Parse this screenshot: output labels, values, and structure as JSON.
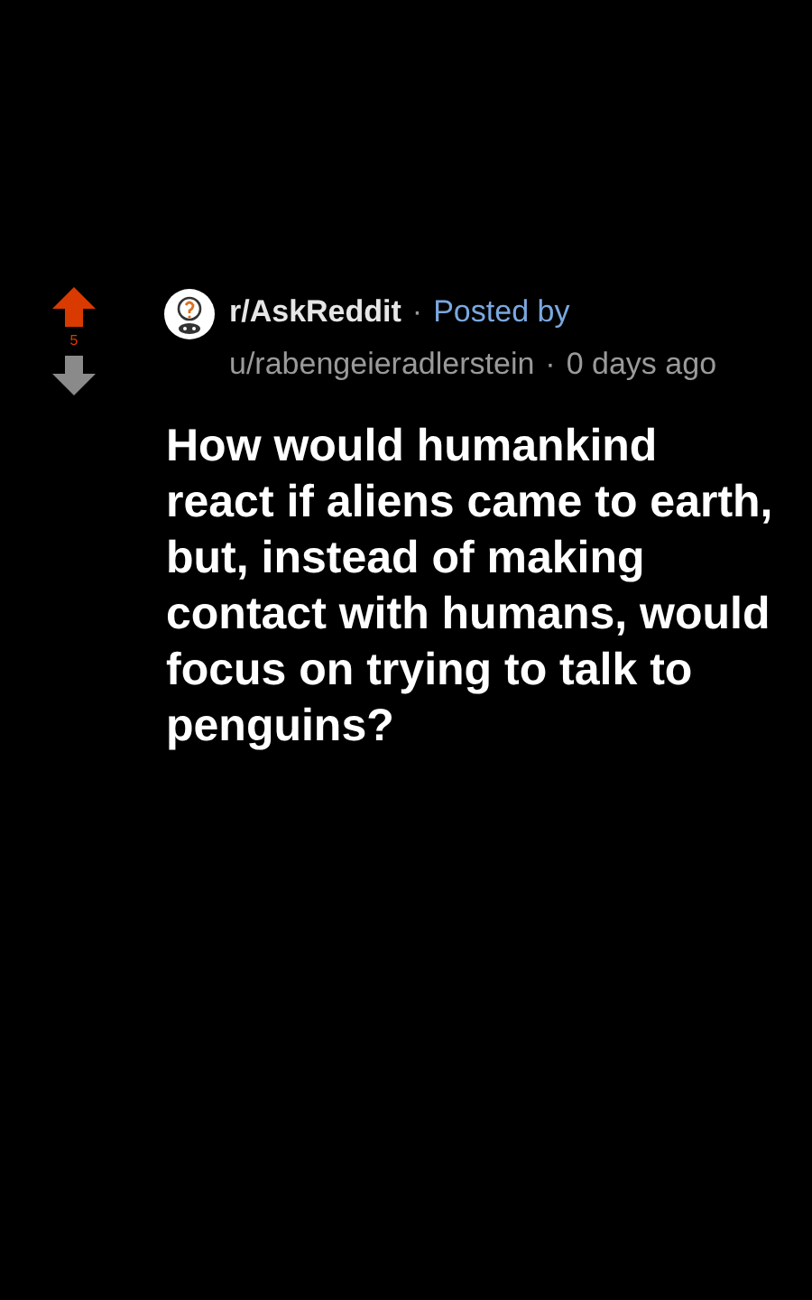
{
  "post": {
    "score": "5",
    "upvoted": true,
    "downvoted": false,
    "subreddit": "r/AskReddit",
    "separator_1": "·",
    "posted_by": "Posted by",
    "author": "u/rabengeieradlerstein",
    "separator_2": "·",
    "time": "0 days ago",
    "title": "How would humankind react if aliens came to earth, but, instead of making contact with humans, would focus on trying to talk to penguins?"
  }
}
